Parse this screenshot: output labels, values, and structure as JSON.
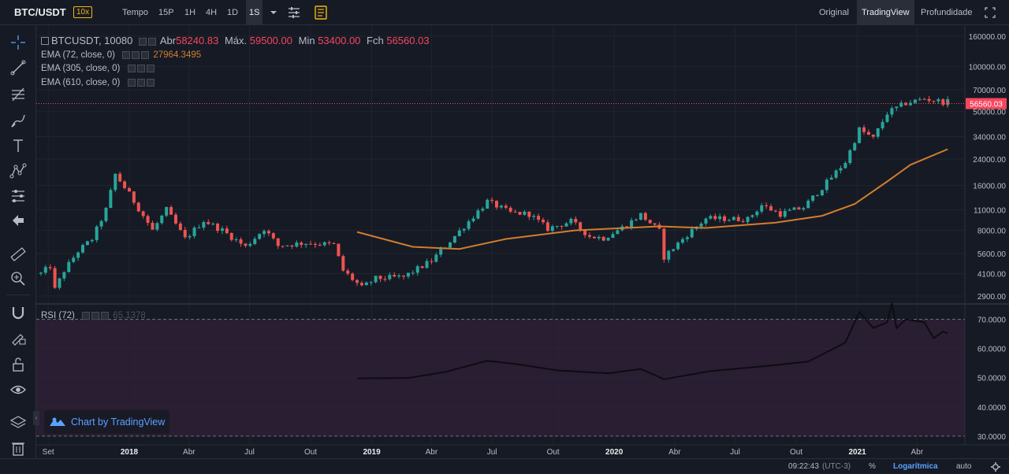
{
  "toolbar": {
    "symbol": "BTC/USDT",
    "leverage": "10x",
    "tempo_label": "Tempo",
    "timeframes": [
      "15P",
      "1H",
      "4H",
      "1D",
      "1S"
    ],
    "active_timeframe": "1S",
    "views": [
      "Original",
      "TradingView",
      "Profundidade"
    ],
    "active_view": "TradingView"
  },
  "legend": {
    "main": {
      "symbol": "BTCUSDT, 10080",
      "open_label": "Abr",
      "open": "58240.83",
      "high_label": "Máx.",
      "high": "59500.00",
      "low_label": "Min",
      "low": "53400.00",
      "close_label": "Fch",
      "close": "56560.03"
    },
    "ema72": {
      "label": "EMA (72, close, 0)",
      "value": "27964.3495"
    },
    "ema305": {
      "label": "EMA (305, close, 0)"
    },
    "ema610": {
      "label": "EMA (610, close, 0)"
    },
    "rsi": {
      "label": "RSI (72)",
      "value": "65.1378"
    }
  },
  "price_axis": {
    "labels": [
      "160000.00",
      "100000.00",
      "70000.00",
      "50000.00",
      "34000.00",
      "24000.00",
      "16000.00",
      "11000.00",
      "8000.00",
      "5600.00",
      "4100.00",
      "2900.00"
    ],
    "last_price": "56560.03"
  },
  "rsi_axis": {
    "labels": [
      "70.0000",
      "60.0000",
      "50.0000",
      "40.0000",
      "30.0000"
    ]
  },
  "time_axis": {
    "labels": [
      "Set",
      "2018",
      "Abr",
      "Jul",
      "Out",
      "2019",
      "Abr",
      "Jul",
      "Out",
      "2020",
      "Abr",
      "Jul",
      "Out",
      "2021",
      "Abr"
    ],
    "bold": [
      "2018",
      "2019",
      "2020",
      "2021"
    ]
  },
  "watermark": "Chart by TradingView",
  "bottom_bar": {
    "time": "09:22:43",
    "timezone": "(UTC-3)",
    "percent": "%",
    "log": "Logarítmica",
    "auto": "auto"
  },
  "colors": {
    "up": "#26a69a",
    "down": "#ef5350",
    "ema": "#d27d2d",
    "rsi_band": "#2a1e33",
    "accent": "#f0b90b",
    "link": "#5aa2ff"
  },
  "chart_data": [
    {
      "type": "candlestick",
      "title": "BTCUSDT, 10080",
      "scale": "log",
      "ylim": [
        2600,
        170000
      ],
      "x_range": [
        "2017-08-14",
        "2021-05-31"
      ],
      "anchors": [
        [
          "2017-08-21",
          4100
        ],
        [
          "2017-09-04",
          4600
        ],
        [
          "2017-09-11",
          3200
        ],
        [
          "2017-09-25",
          4300
        ],
        [
          "2017-10-16",
          5800
        ],
        [
          "2017-11-06",
          7000
        ],
        [
          "2017-11-27",
          11000
        ],
        [
          "2017-12-11",
          19000
        ],
        [
          "2018-01-01",
          14000
        ],
        [
          "2018-01-29",
          9000
        ],
        [
          "2018-02-05",
          8000
        ],
        [
          "2018-02-26",
          11000
        ],
        [
          "2018-03-26",
          7000
        ],
        [
          "2018-04-23",
          9300
        ],
        [
          "2018-05-21",
          8000
        ],
        [
          "2018-06-25",
          6200
        ],
        [
          "2018-07-23",
          8200
        ],
        [
          "2018-08-13",
          6300
        ],
        [
          "2018-09-24",
          6600
        ],
        [
          "2018-11-05",
          6400
        ],
        [
          "2018-11-19",
          4300
        ],
        [
          "2018-12-17",
          3300
        ],
        [
          "2019-01-07",
          3800
        ],
        [
          "2019-02-18",
          3900
        ],
        [
          "2019-04-01",
          5000
        ],
        [
          "2019-05-13",
          7900
        ],
        [
          "2019-06-24",
          12500
        ],
        [
          "2019-07-29",
          10500
        ],
        [
          "2019-08-26",
          10300
        ],
        [
          "2019-09-23",
          8200
        ],
        [
          "2019-10-28",
          9200
        ],
        [
          "2019-11-25",
          7300
        ],
        [
          "2019-12-16",
          7100
        ],
        [
          "2020-01-20",
          8700
        ],
        [
          "2020-02-10",
          10200
        ],
        [
          "2020-03-09",
          7900
        ],
        [
          "2020-03-16",
          5300
        ],
        [
          "2020-04-20",
          7500
        ],
        [
          "2020-05-18",
          9600
        ],
        [
          "2020-07-20",
          9500
        ],
        [
          "2020-08-10",
          11800
        ],
        [
          "2020-09-07",
          10300
        ],
        [
          "2020-10-12",
          11400
        ],
        [
          "2020-11-09",
          15500
        ],
        [
          "2020-12-14",
          23000
        ],
        [
          "2021-01-04",
          38000
        ],
        [
          "2021-01-25",
          33000
        ],
        [
          "2021-02-15",
          49000
        ],
        [
          "2021-03-15",
          57000
        ],
        [
          "2021-04-12",
          61000
        ],
        [
          "2021-05-10",
          58000
        ]
      ],
      "last": {
        "date": "2021-05-17",
        "open": 58240.83,
        "high": 59500.0,
        "low": 53400.0,
        "close": 56560.03
      }
    },
    {
      "type": "line",
      "name": "EMA (72, close, 0)",
      "x_range": [
        "2018-12-10",
        "2021-05-17"
      ],
      "points": [
        [
          "2018-12-10",
          7800
        ],
        [
          "2019-03-04",
          6200
        ],
        [
          "2019-05-13",
          6000
        ],
        [
          "2019-07-22",
          7000
        ],
        [
          "2019-11-04",
          8000
        ],
        [
          "2020-03-09",
          8500
        ],
        [
          "2020-05-18",
          8300
        ],
        [
          "2020-08-31",
          9000
        ],
        [
          "2020-11-09",
          10000
        ],
        [
          "2020-12-28",
          12000
        ],
        [
          "2021-02-15",
          17000
        ],
        [
          "2021-03-22",
          22000
        ],
        [
          "2021-05-17",
          27964.35
        ]
      ]
    },
    {
      "type": "line",
      "name": "RSI (72)",
      "ylim": [
        27,
        75
      ],
      "x_range": [
        "2018-12-10",
        "2021-05-17"
      ],
      "points": [
        [
          "2018-12-10",
          49.8
        ],
        [
          "2019-02-25",
          49.9
        ],
        [
          "2019-04-22",
          52
        ],
        [
          "2019-06-24",
          55.8
        ],
        [
          "2019-08-12",
          54.5
        ],
        [
          "2019-10-07",
          52.5
        ],
        [
          "2019-12-23",
          51.5
        ],
        [
          "2020-02-10",
          53
        ],
        [
          "2020-03-16",
          49.5
        ],
        [
          "2020-05-25",
          52.3
        ],
        [
          "2020-08-17",
          54
        ],
        [
          "2020-10-19",
          55.5
        ],
        [
          "2020-12-14",
          62
        ],
        [
          "2021-01-04",
          72.5
        ],
        [
          "2021-01-25",
          67
        ],
        [
          "2021-02-15",
          69
        ],
        [
          "2021-02-22",
          75.5
        ],
        [
          "2021-03-01",
          67
        ],
        [
          "2021-03-15",
          70
        ],
        [
          "2021-04-12",
          69
        ],
        [
          "2021-04-26",
          63.5
        ],
        [
          "2021-05-10",
          65.8
        ],
        [
          "2021-05-17",
          65.14
        ]
      ]
    }
  ]
}
